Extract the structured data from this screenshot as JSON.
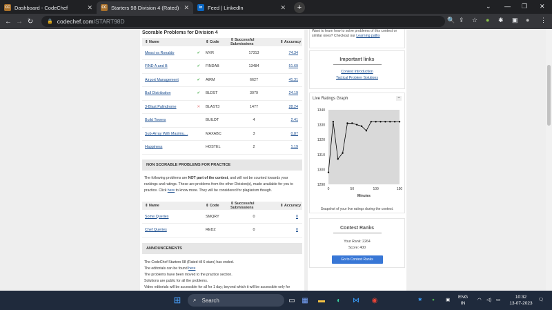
{
  "browser": {
    "tabs": [
      {
        "title": "Dashboard - CodeChef",
        "favicon": "CC",
        "active": false
      },
      {
        "title": "Starters 98 Division 4 (Rated) Co",
        "favicon": "CC",
        "active": true
      },
      {
        "title": "Feed | LinkedIn",
        "favicon": "in",
        "active": false
      }
    ],
    "url_host": "codechef.com",
    "url_path": "/START98D"
  },
  "problems": {
    "title": "Scorable Problems for Division 4",
    "headers": [
      "Name",
      "Code",
      "Successful Submissions",
      "Accuracy"
    ],
    "rows": [
      {
        "name": "Messi vs Ronaldo",
        "status": "✔",
        "code": "MVR",
        "subs": "17313",
        "acc": "74.34"
      },
      {
        "name": "FIND A and B",
        "status": "✔",
        "code": "FINDAB",
        "subs": "13484",
        "acc": "51.69"
      },
      {
        "name": "Airport Management",
        "status": "✔",
        "code": "AIRM",
        "subs": "6627",
        "acc": "41.31"
      },
      {
        "name": "Ball Distribution",
        "status": "✔",
        "code": "BLDST",
        "subs": "3079",
        "acc": "24.19"
      },
      {
        "name": "3-Blast Palindrome",
        "status": "✕",
        "code": "BLAST3",
        "subs": "1477",
        "acc": "28.24"
      },
      {
        "name": "Build Towers",
        "status": "",
        "code": "BUILDT",
        "subs": "4",
        "acc": "2.41"
      },
      {
        "name": "Sub-Array With Maximu…",
        "status": "",
        "code": "MAXABC",
        "subs": "3",
        "acc": "0.87"
      },
      {
        "name": "Happiness",
        "status": "",
        "code": "HOSTEL",
        "subs": "2",
        "acc": "1.19"
      }
    ]
  },
  "nonscorable": {
    "title": "NON SCORABLE PROBLEMS FOR PRACTICE",
    "para_1": "The following problems are ",
    "para_bold": "NOT part of the contest",
    "para_2": ", and will not be counted towards your rankings and ratings. These are problems from the other Division(s), made available for you to practice. Click ",
    "para_link": "here",
    "para_3": " to know more. They will be considered for plagiarism though.",
    "headers": [
      "Name",
      "Code",
      "Successful Submissions",
      "Accuracy"
    ],
    "rows": [
      {
        "name": "Some Queries",
        "code": "SMQRY",
        "subs": "0",
        "acc": "0"
      },
      {
        "name": "Chef Queries",
        "code": "REDZ",
        "subs": "0",
        "acc": "0"
      }
    ]
  },
  "announcements": {
    "title": "ANNOUNCEMENTS",
    "lines": [
      "The CodeChef Starters 98 (Rated till 6-stars) has ended.",
      "The editorials can be found ",
      "The problems have been moved to the practice section.",
      "Solutions are public for all the problems.",
      "Video editorials will be accessible for all for 1 day; beyond which it will be accessible only for"
    ],
    "here_link": "here"
  },
  "sidebar": {
    "learn_text": "Want to learn how to solve problems of this contest or similar ones? Checkout our ",
    "learn_link": "Learning paths",
    "important_title": "Important links",
    "links": [
      "Contest Introduction",
      "Tactical Problem Solutions"
    ],
    "graph_title": "Live Ratings Graph",
    "graph_caption": "Snapshot of your live ratings during the contest.",
    "ranks_title": "Contest Ranks",
    "your_rank": "Your Rank: 2264",
    "score": "Score: 400",
    "ranks_button": "Go to Contest Ranks"
  },
  "chart_data": {
    "type": "line",
    "x": [
      0,
      10,
      20,
      30,
      40,
      50,
      60,
      70,
      80,
      90,
      100,
      110,
      120,
      130,
      140,
      150
    ],
    "series": [
      {
        "values": [
          1298,
          1332,
          1307,
          1311,
          1331,
          1331,
          1330,
          1329,
          1326,
          1332,
          1332,
          1332,
          1332,
          1332,
          1332,
          1332
        ]
      }
    ],
    "xticks": [
      0,
      50,
      100,
      150
    ],
    "yticks": [
      1290,
      1300,
      1310,
      1320,
      1330,
      1340
    ],
    "xlim": [
      0,
      150
    ],
    "ylim": [
      1290,
      1340
    ],
    "xlabel": "Minutes",
    "ylabel": "",
    "grid": false,
    "colors": {
      "line": "#000000",
      "plot_bg": "#d9d9d9"
    }
  },
  "taskbar": {
    "search": "Search",
    "lang_1": "ENG",
    "lang_2": "IN",
    "time": "10:32",
    "date": "13-07-2023"
  }
}
